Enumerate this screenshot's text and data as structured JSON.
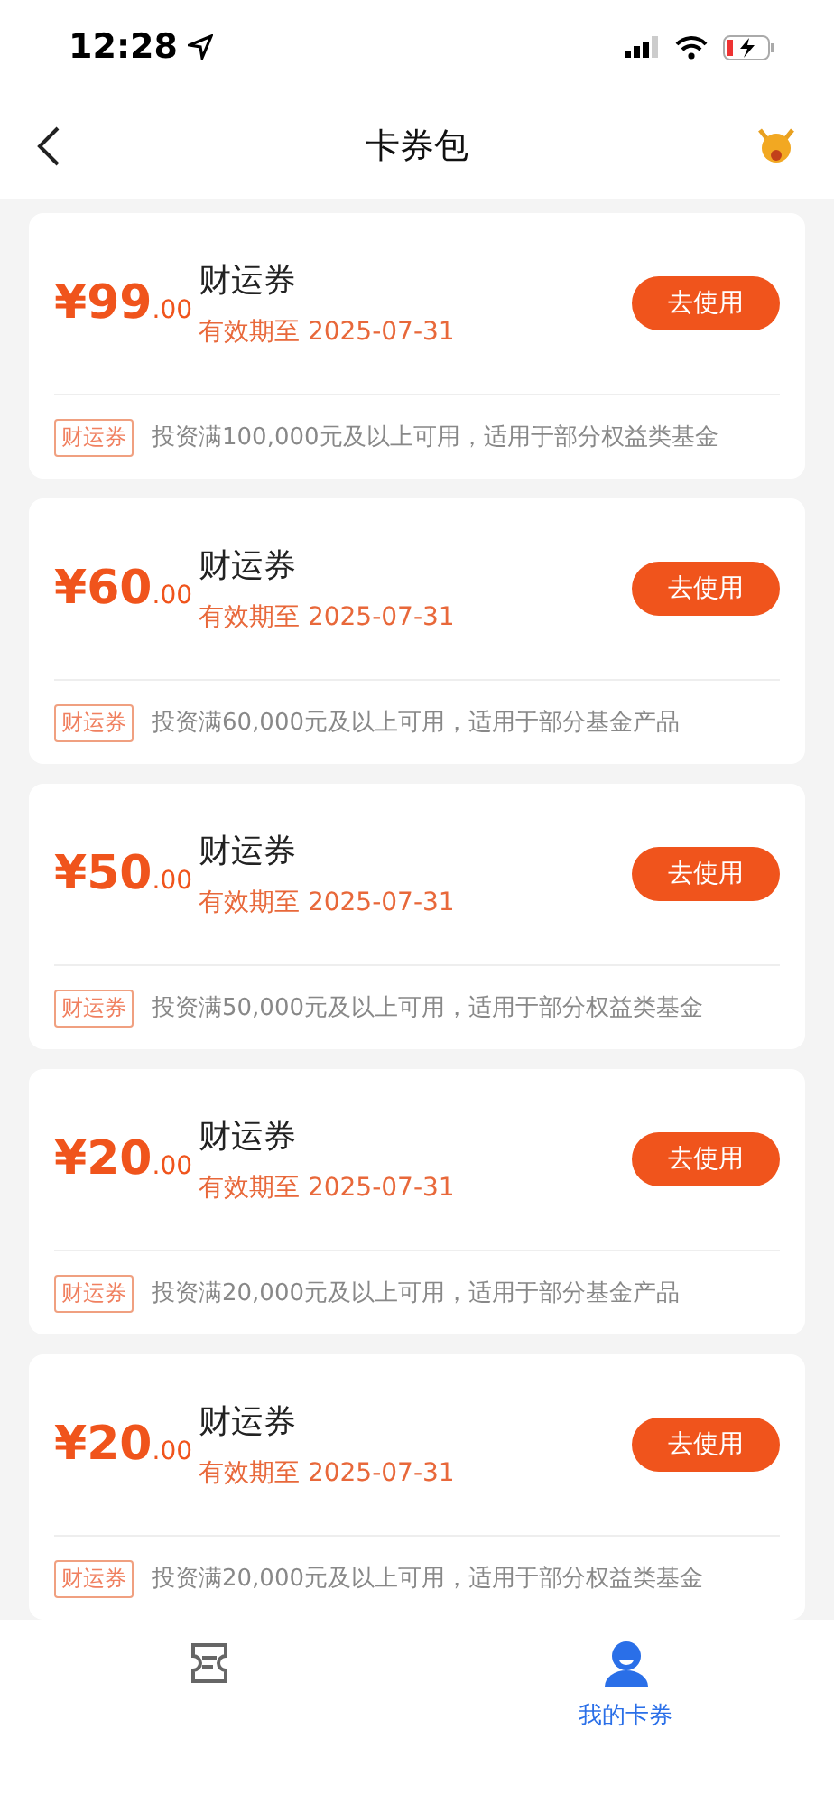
{
  "status_bar": {
    "time": "12:28"
  },
  "nav": {
    "title": "卡券包"
  },
  "coupons": [
    {
      "amount": "¥99",
      "decimals": ".00",
      "name": "财运券",
      "expiry": "有效期至 2025-07-31",
      "action": "去使用",
      "tag": "财运券",
      "condition": "投资满100,000元及以上可用，适用于部分权益类基金"
    },
    {
      "amount": "¥60",
      "decimals": ".00",
      "name": "财运券",
      "expiry": "有效期至 2025-07-31",
      "action": "去使用",
      "tag": "财运券",
      "condition": "投资满60,000元及以上可用，适用于部分基金产品"
    },
    {
      "amount": "¥50",
      "decimals": ".00",
      "name": "财运券",
      "expiry": "有效期至 2025-07-31",
      "action": "去使用",
      "tag": "财运券",
      "condition": "投资满50,000元及以上可用，适用于部分权益类基金"
    },
    {
      "amount": "¥20",
      "decimals": ".00",
      "name": "财运券",
      "expiry": "有效期至 2025-07-31",
      "action": "去使用",
      "tag": "财运券",
      "condition": "投资满20,000元及以上可用，适用于部分基金产品"
    },
    {
      "amount": "¥20",
      "decimals": ".00",
      "name": "财运券",
      "expiry": "有效期至 2025-07-31",
      "action": "去使用",
      "tag": "财运券",
      "condition": "投资满20,000元及以上可用，适用于部分权益类基金"
    }
  ],
  "tab_bar": [
    {
      "kind": "ticket",
      "selected": false
    },
    {
      "kind": "person",
      "label": "我的卡券",
      "selected": true
    }
  ]
}
